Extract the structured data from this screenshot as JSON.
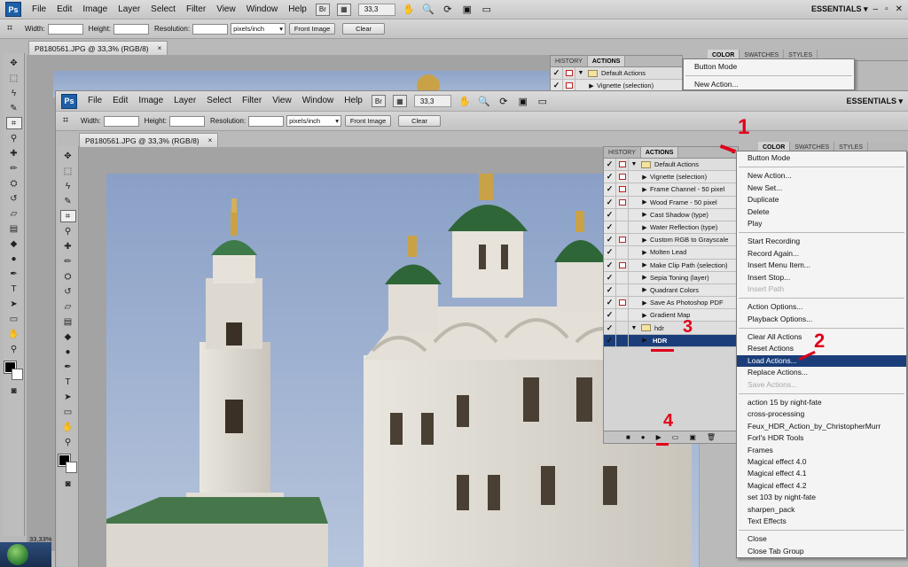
{
  "app": {
    "logo": "Ps",
    "menu": [
      "File",
      "Edit",
      "Image",
      "Layer",
      "Select",
      "Filter",
      "View",
      "Window",
      "Help"
    ],
    "bridge_label": "Br",
    "zoom": "33,3",
    "workspace": "ESSENTIALS",
    "window_controls": [
      "–",
      "▫",
      "✕"
    ]
  },
  "options_bar": {
    "width_label": "Width:",
    "height_label": "Height:",
    "resolution_label": "Resolution:",
    "units": "pixels/inch",
    "front_image": "Front Image",
    "clear": "Clear"
  },
  "document": {
    "tab_title": "P8180561.JPG @ 33,3% (RGB/8)",
    "close": "×",
    "status_zoom": "33,33%"
  },
  "actions_panel": {
    "tabs": [
      "HISTORY",
      "ACTIONS"
    ],
    "rows": [
      {
        "label": "Default Actions",
        "type": "set",
        "dialog": true
      },
      {
        "label": "Vignette (selection)",
        "type": "action",
        "dialog": true
      },
      {
        "label": "Frame Channel - 50 pixel",
        "type": "action",
        "dialog": true
      },
      {
        "label": "Wood Frame - 50 pixel",
        "type": "action",
        "dialog": true
      },
      {
        "label": "Cast Shadow (type)",
        "type": "action",
        "dialog": false
      },
      {
        "label": "Water Reflection (type)",
        "type": "action",
        "dialog": false
      },
      {
        "label": "Custom RGB to Grayscale",
        "type": "action",
        "dialog": true
      },
      {
        "label": "Molten Lead",
        "type": "action",
        "dialog": false
      },
      {
        "label": "Make Clip Path (selection)",
        "type": "action",
        "dialog": true
      },
      {
        "label": "Sepia Toning (layer)",
        "type": "action",
        "dialog": false
      },
      {
        "label": "Quadrant Colors",
        "type": "action",
        "dialog": false
      },
      {
        "label": "Save As Photoshop PDF",
        "type": "action",
        "dialog": true
      },
      {
        "label": "Gradient Map",
        "type": "action",
        "dialog": false
      },
      {
        "label": "hdr",
        "type": "set",
        "dialog": false
      },
      {
        "label": "HDR",
        "type": "action",
        "dialog": false,
        "selected": true
      }
    ],
    "footer_buttons": [
      "■",
      "●",
      "▶",
      "▭",
      "▣",
      "🗑"
    ]
  },
  "back_actions_panel": {
    "tabs": [
      "HISTORY",
      "ACTIONS"
    ],
    "rows": [
      "Default Actions",
      "Vignette (selection)"
    ]
  },
  "right_tabs": [
    "COLOR",
    "SWATCHES",
    "STYLES"
  ],
  "back_menu": [
    "Button Mode",
    "New Action..."
  ],
  "flyout_menu": [
    {
      "label": "Button Mode"
    },
    {
      "sep": true
    },
    {
      "label": "New Action..."
    },
    {
      "label": "New Set..."
    },
    {
      "label": "Duplicate"
    },
    {
      "label": "Delete"
    },
    {
      "label": "Play"
    },
    {
      "sep": true
    },
    {
      "label": "Start Recording"
    },
    {
      "label": "Record Again..."
    },
    {
      "label": "Insert Menu Item..."
    },
    {
      "label": "Insert Stop..."
    },
    {
      "label": "Insert Path",
      "disabled": true
    },
    {
      "sep": true
    },
    {
      "label": "Action Options..."
    },
    {
      "label": "Playback Options..."
    },
    {
      "sep": true
    },
    {
      "label": "Clear All Actions"
    },
    {
      "label": "Reset Actions"
    },
    {
      "label": "Load Actions...",
      "highlight": true
    },
    {
      "label": "Replace Actions..."
    },
    {
      "label": "Save Actions...",
      "disabled": true
    },
    {
      "sep": true
    },
    {
      "label": "action 15 by night-fate"
    },
    {
      "label": "cross-processing"
    },
    {
      "label": "Feux_HDR_Action_by_ChristopherMurr"
    },
    {
      "label": "Forl's HDR Tools"
    },
    {
      "label": "Frames"
    },
    {
      "label": "Magical effect 4.0"
    },
    {
      "label": "Magical effect 4.1"
    },
    {
      "label": "Magical effect 4.2"
    },
    {
      "label": "set 103 by night-fate"
    },
    {
      "label": "sharpen_pack"
    },
    {
      "label": "Text Effects"
    },
    {
      "sep": true
    },
    {
      "label": "Close"
    },
    {
      "label": "Close Tab Group"
    }
  ],
  "annotations": [
    "1",
    "2",
    "3",
    "4"
  ],
  "colors": {
    "accent": "#1b3e7a",
    "annotation": "#e0001b"
  }
}
